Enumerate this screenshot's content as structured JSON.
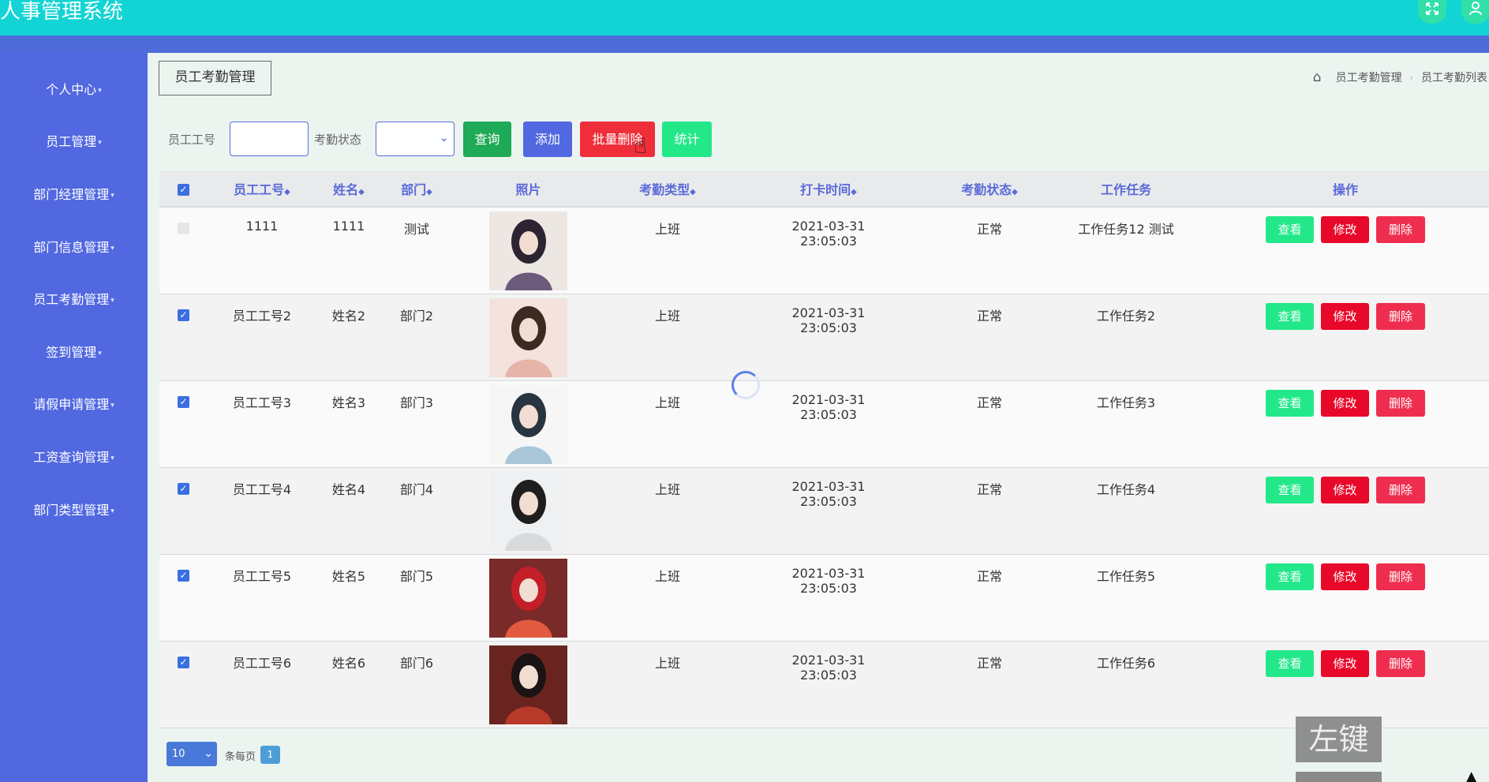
{
  "app": {
    "title": "人事管理系统"
  },
  "header_icons": {
    "expand": "expand-icon",
    "user": "user-icon"
  },
  "sidebar": {
    "items": [
      {
        "label": "个人中心"
      },
      {
        "label": "员工管理"
      },
      {
        "label": "部门经理管理"
      },
      {
        "label": "部门信息管理"
      },
      {
        "label": "员工考勤管理"
      },
      {
        "label": "签到管理"
      },
      {
        "label": "请假申请管理"
      },
      {
        "label": "工资查询管理"
      },
      {
        "label": "部门类型管理"
      }
    ]
  },
  "page": {
    "title": "员工考勤管理"
  },
  "breadcrumb": {
    "level1": "员工考勤管理",
    "level2": "员工考勤列表"
  },
  "search": {
    "emp_no_label": "员工工号",
    "emp_no_value": "",
    "status_label": "考勤状态",
    "status_value": ""
  },
  "buttons": {
    "query": "查询",
    "add": "添加",
    "batch_delete": "批量删除",
    "stats": "统计"
  },
  "table": {
    "headers": {
      "emp_no": "员工工号",
      "name": "姓名",
      "dept": "部门",
      "photo": "照片",
      "type": "考勤类型",
      "time": "打卡时间",
      "status": "考勤状态",
      "task": "工作任务",
      "ops": "操作"
    },
    "actions": {
      "view": "查看",
      "edit": "修改",
      "delete": "删除"
    },
    "rows": [
      {
        "checked": false,
        "emp_no": "1111",
        "name": "1111",
        "dept": "测试",
        "type": "上班",
        "time": "2021-03-31 23:05:03",
        "status": "正常",
        "task": "工作任务12 测试"
      },
      {
        "checked": true,
        "emp_no": "员工工号2",
        "name": "姓名2",
        "dept": "部门2",
        "type": "上班",
        "time": "2021-03-31 23:05:03",
        "status": "正常",
        "task": "工作任务2"
      },
      {
        "checked": true,
        "emp_no": "员工工号3",
        "name": "姓名3",
        "dept": "部门3",
        "type": "上班",
        "time": "2021-03-31 23:05:03",
        "status": "正常",
        "task": "工作任务3"
      },
      {
        "checked": true,
        "emp_no": "员工工号4",
        "name": "姓名4",
        "dept": "部门4",
        "type": "上班",
        "time": "2021-03-31 23:05:03",
        "status": "正常",
        "task": "工作任务4"
      },
      {
        "checked": true,
        "emp_no": "员工工号5",
        "name": "姓名5",
        "dept": "部门5",
        "type": "上班",
        "time": "2021-03-31 23:05:03",
        "status": "正常",
        "task": "工作任务5"
      },
      {
        "checked": true,
        "emp_no": "员工工号6",
        "name": "姓名6",
        "dept": "部门6",
        "type": "上班",
        "time": "2021-03-31 23:05:03",
        "status": "正常",
        "task": "工作任务6"
      }
    ]
  },
  "pagination": {
    "page_size": "10",
    "per_page_label": "条每页",
    "current_page": "1"
  },
  "overlay": {
    "key_label": "左键"
  },
  "colors": {
    "topbar": "#12d4d4",
    "sidebar": "#5168e0",
    "view": "#23e88a",
    "edit": "#e8082a",
    "delete": "#ef2e4f"
  }
}
